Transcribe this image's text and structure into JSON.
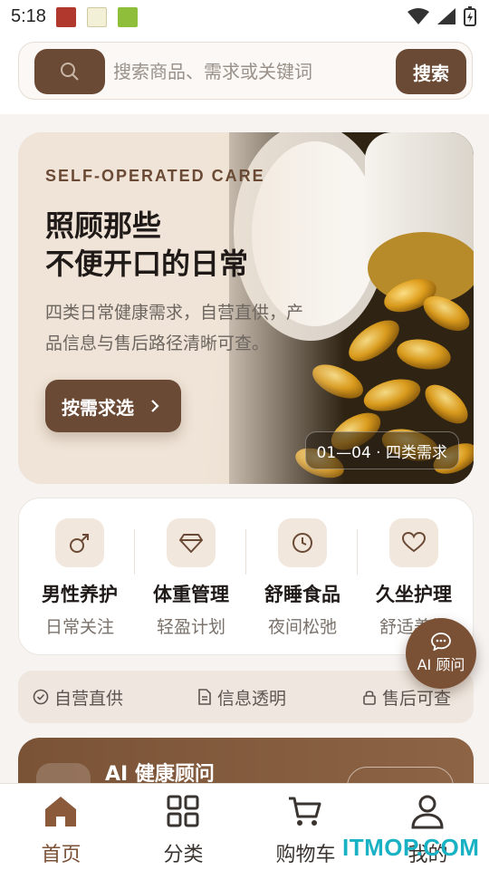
{
  "status_bar": {
    "time": "5:18"
  },
  "search": {
    "placeholder": "搜索商品、需求或关键词",
    "button_label": "搜索"
  },
  "hero": {
    "kicker": "SELF-OPERATED CARE",
    "title_line1": "照顾那些",
    "title_line2": "不便开口的日常",
    "desc_line1": "四类日常健康需求，自营直供，产",
    "desc_line2": "品信息与售后路径清晰可查。",
    "cta_label": "按需求选",
    "badge": "01—04 · 四类需求"
  },
  "categories": [
    {
      "name": "男性养护",
      "sub": "日常关注",
      "icon": "male-symbol-icon"
    },
    {
      "name": "体重管理",
      "sub": "轻盈计划",
      "icon": "gem-icon"
    },
    {
      "name": "舒睡食品",
      "sub": "夜间松弛",
      "icon": "clock-icon"
    },
    {
      "name": "久坐护理",
      "sub": "舒适养护",
      "icon": "heart-icon"
    }
  ],
  "ai_float": {
    "label": "AI 顾问"
  },
  "features": [
    {
      "label": "自营直供",
      "icon": "check-circle-icon"
    },
    {
      "label": "信息透明",
      "icon": "document-icon"
    },
    {
      "label": "售后可查",
      "icon": "lock-icon"
    }
  ],
  "ai_card": {
    "title": "AI 健康顾问"
  },
  "tabs": [
    {
      "label": "首页",
      "icon": "home-icon",
      "active": true
    },
    {
      "label": "分类",
      "icon": "grid-icon",
      "active": false
    },
    {
      "label": "购物车",
      "icon": "cart-icon",
      "active": false
    },
    {
      "label": "我的",
      "icon": "user-icon",
      "active": false
    }
  ],
  "watermark": "ITMOP.COM",
  "colors": {
    "brand_brown": "#6b4a35",
    "accent_brown": "#7b5136",
    "watermark_teal": "#19b1c4"
  }
}
